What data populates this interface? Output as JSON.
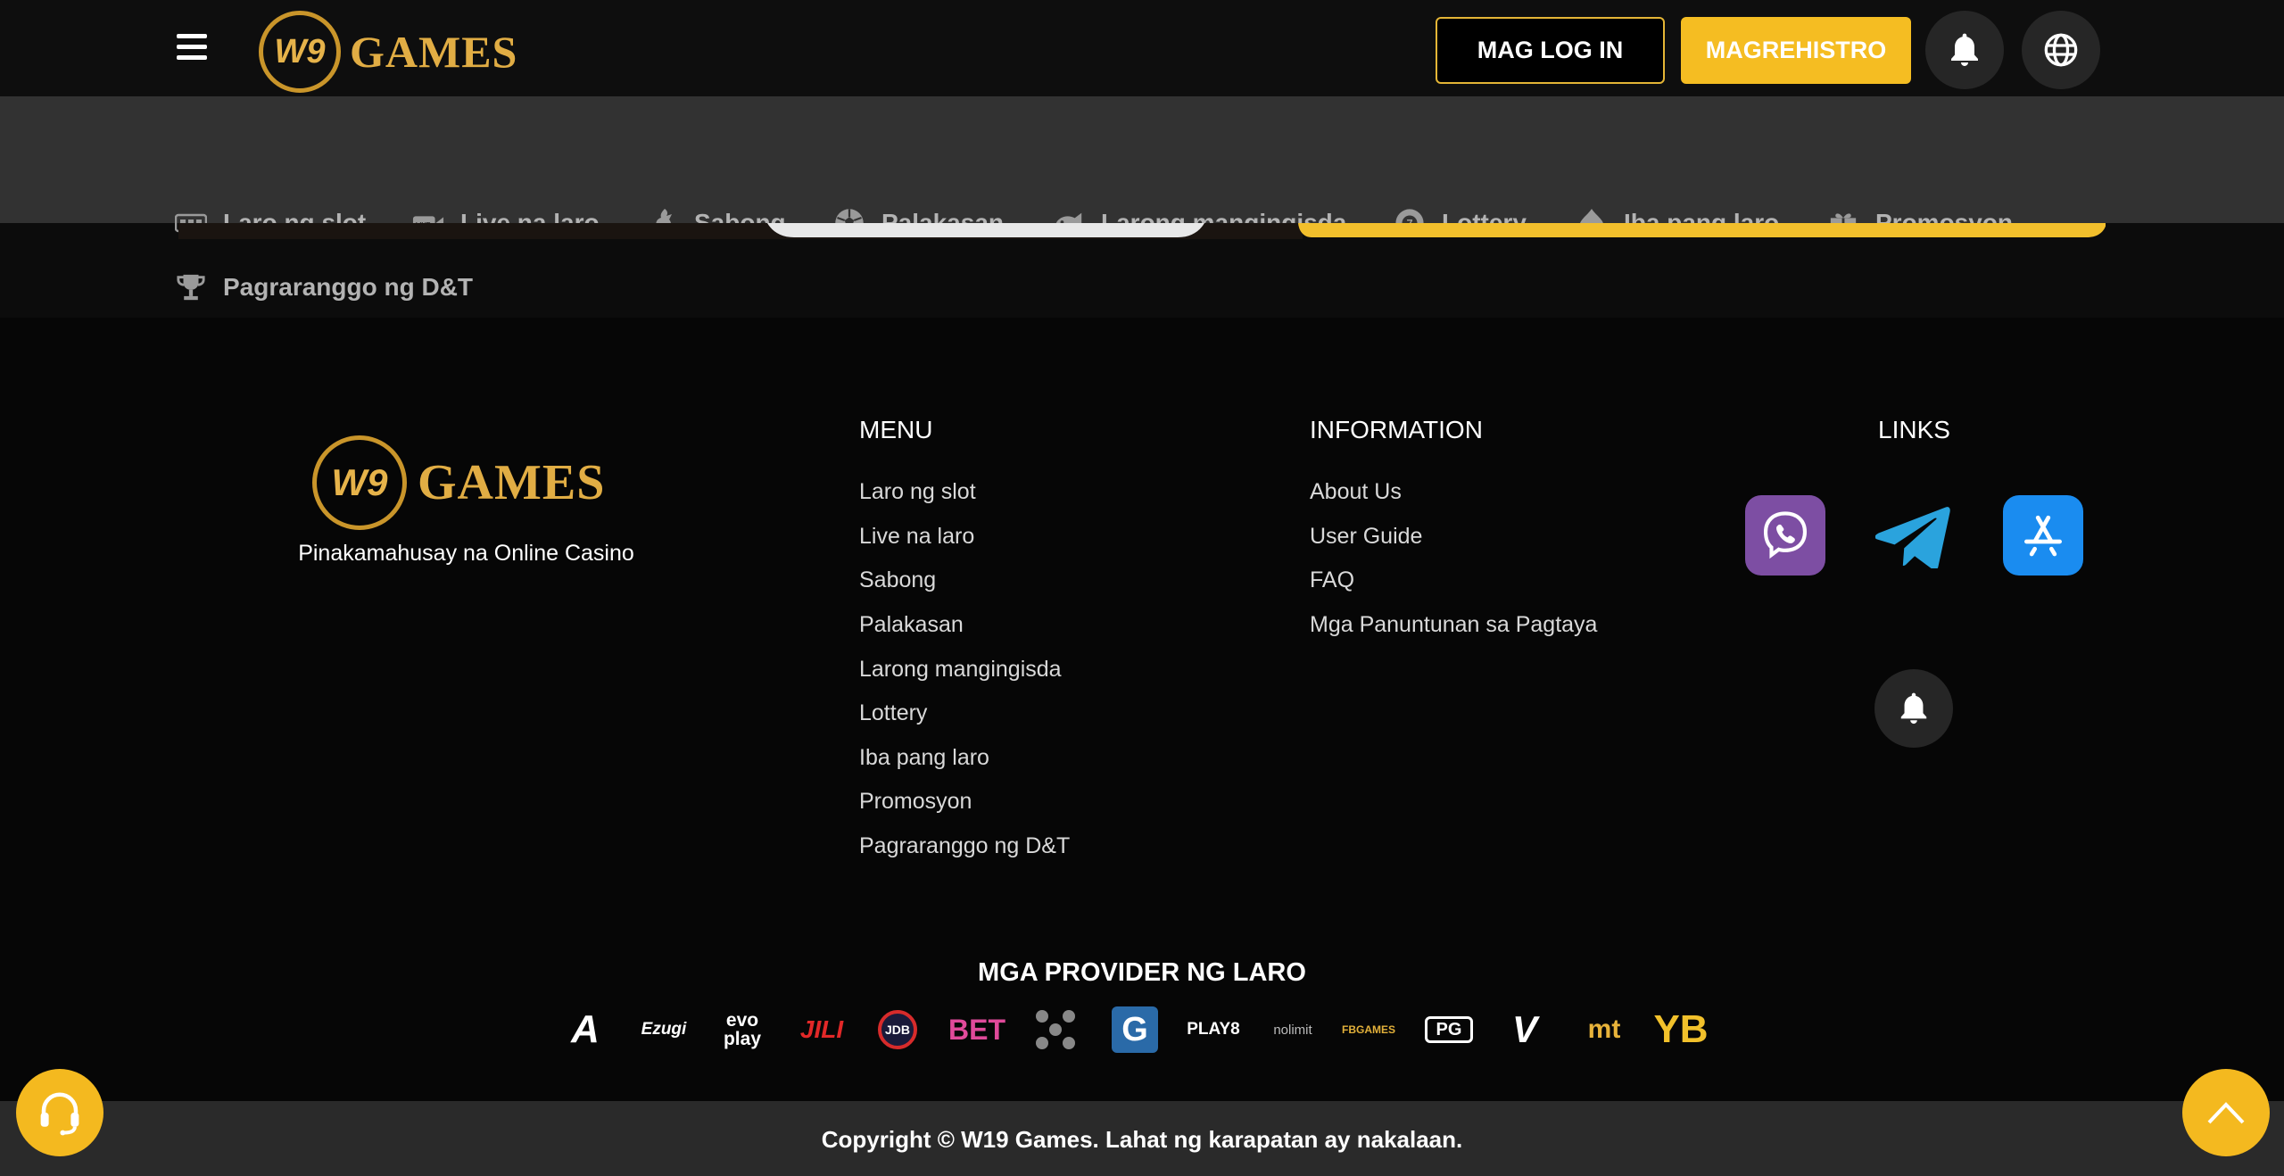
{
  "header": {
    "logo_text": "GAMES",
    "logo_mark": "W9",
    "login_label": "MAG LOG IN",
    "register_label": "MAGREHISTRO",
    "icons": [
      "menu-icon",
      "bell-icon",
      "globe-icon"
    ]
  },
  "categories": [
    {
      "label": "Laro ng slot",
      "icon": "slot-machine-icon"
    },
    {
      "label": "Live na laro",
      "icon": "live-icon"
    },
    {
      "label": "Sabong",
      "icon": "rooster-icon"
    },
    {
      "label": "Palakasan",
      "icon": "soccer-ball-icon"
    },
    {
      "label": "Larong mangingisda",
      "icon": "fish-icon"
    },
    {
      "label": "Lottery",
      "icon": "lottery-ball-icon"
    },
    {
      "label": "Iba pang laro",
      "icon": "spade-icon"
    },
    {
      "label": "Promosyon",
      "icon": "gift-icon"
    },
    {
      "label": "Pagraranggo ng D&T",
      "icon": "trophy-icon"
    }
  ],
  "footer": {
    "logo_text": "GAMES",
    "logo_mark": "W9",
    "tagline": "Pinakamahusay na Online Casino",
    "menu_title": "MENU",
    "menu": [
      "Laro ng slot",
      "Live na laro",
      "Sabong",
      "Palakasan",
      "Larong mangingisda",
      "Lottery",
      "Iba pang laro",
      "Promosyon",
      "Pagraranggo ng D&T"
    ],
    "info_title": "INFORMATION",
    "info": [
      "About Us",
      "User Guide",
      "FAQ",
      "Mga Panuntunan sa Pagtaya"
    ],
    "links_title": "LINKS",
    "links": [
      "viber-icon",
      "telegram-icon",
      "app-store-icon",
      "bell-icon"
    ],
    "providers_title": "MGA PROVIDER NG LARO",
    "providers": [
      "A",
      "Ezugi",
      "evo play",
      "JILI",
      "JDB",
      "BET",
      "",
      "G",
      "PLAY8",
      "nolimit",
      "FBGAMES",
      "PG",
      "V",
      "mt",
      "YB"
    ],
    "copyright": "Copyright © W19 Games. Lahat ng karapatan ay nakalaan."
  },
  "colors": {
    "accent": "#f5bd22",
    "gold_text": "#e1ad44",
    "header_bg": "#0e0e0e",
    "nav_bg": "#323232",
    "footer_bg": "#060606",
    "viber": "#7d4ea3",
    "telegram": "#2aa3dd",
    "app_store": "#1a8cf0"
  }
}
